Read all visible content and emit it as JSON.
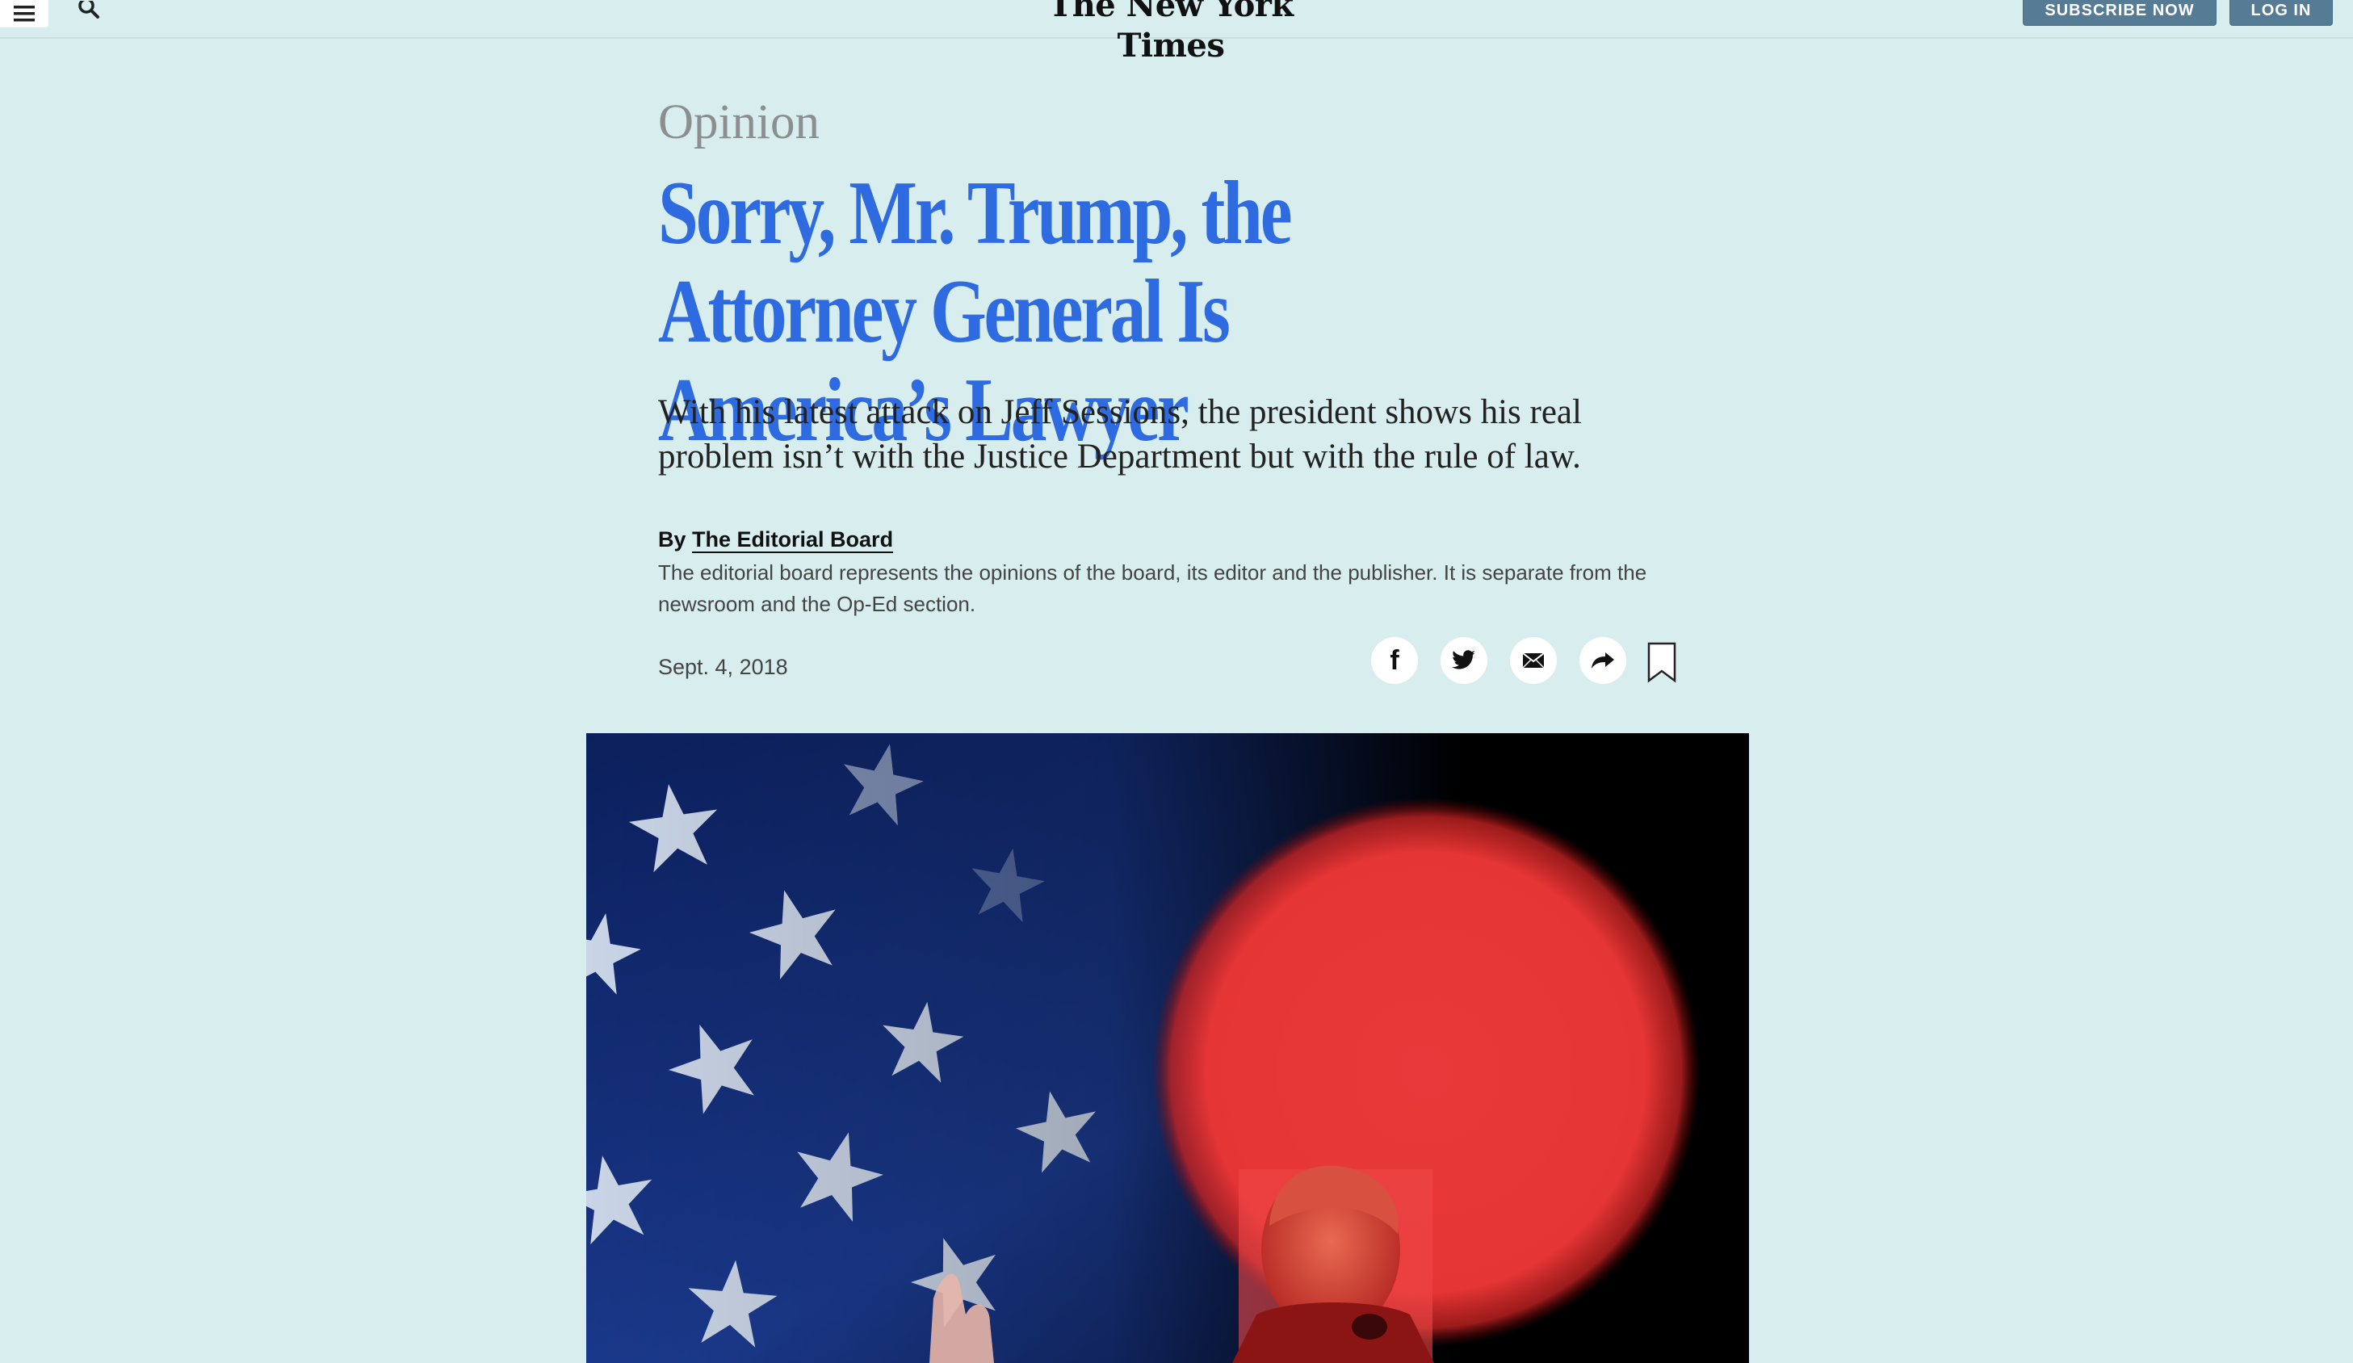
{
  "header": {
    "masthead": "The New York Times",
    "subscribe_label": "SUBSCRIBE NOW",
    "login_label": "LOG IN",
    "menu_icon": "hamburger-menu-icon",
    "search_icon": "search-icon"
  },
  "article": {
    "section": "Opinion",
    "headline": "Sorry, Mr. Trump, the Attorney General Is America’s Lawyer",
    "summary": "With his latest attack on Jeff Sessions, the president shows his real problem isn’t with the Justice Department but with the rule of law.",
    "byline_prefix": "By",
    "byline_author": "The Editorial Board",
    "byline_description": "The editorial board represents the opinions of the board, its editor and the publisher. It is separate from the newsroom and the Op-Ed section.",
    "date": "Sept. 4, 2018"
  },
  "share": {
    "icons": [
      "facebook-icon",
      "twitter-icon",
      "email-icon",
      "share-icon",
      "bookmark-icon"
    ]
  },
  "colors": {
    "page_background": "#d7edee",
    "headline": "#2f6be0",
    "section_label": "#8b8f90",
    "header_button": "#567b95"
  }
}
